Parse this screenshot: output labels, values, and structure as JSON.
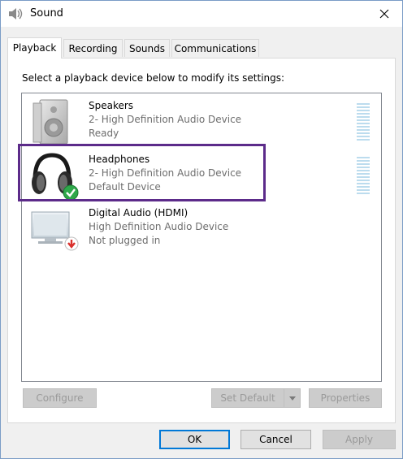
{
  "window": {
    "title": "Sound",
    "title_icon": "speaker-icon",
    "close_icon": "close-icon"
  },
  "tabs": [
    {
      "label": "Playback",
      "active": true
    },
    {
      "label": "Recording",
      "active": false
    },
    {
      "label": "Sounds",
      "active": false
    },
    {
      "label": "Communications",
      "active": false
    }
  ],
  "playback": {
    "instruction": "Select a playback device below to modify its settings:",
    "devices": [
      {
        "name": "Speakers",
        "line1": "2- High Definition Audio Device",
        "line2": "Ready",
        "icon": "speakers-icon"
      },
      {
        "name": "Headphones",
        "line1": "2- High Definition Audio Device",
        "line2": "Default Device",
        "icon": "headphones-icon",
        "badge": "default-check-icon"
      },
      {
        "name": "Digital Audio (HDMI)",
        "line1": "High Definition Audio Device",
        "line2": "Not plugged in",
        "icon": "monitor-icon",
        "badge": "unplugged-arrow-icon"
      }
    ]
  },
  "buttons": {
    "configure": "Configure",
    "set_default": "Set Default",
    "properties": "Properties",
    "ok": "OK",
    "cancel": "Cancel",
    "apply": "Apply"
  },
  "colors": {
    "highlight": "#5c2b8a",
    "check_badge": "#2ea84a",
    "unplugged_badge": "#d9302c",
    "level_meter": "#bcdcee"
  }
}
